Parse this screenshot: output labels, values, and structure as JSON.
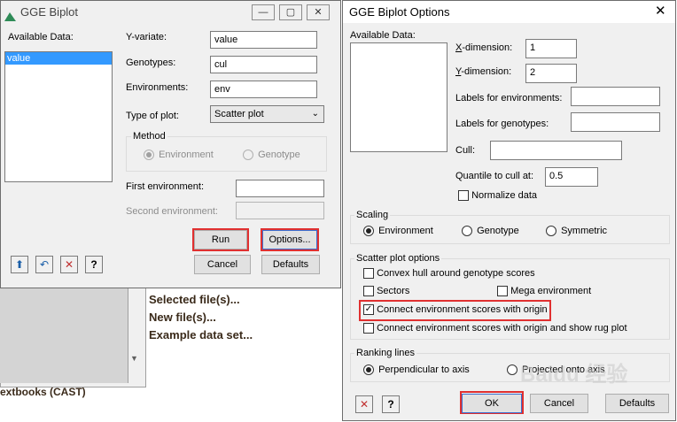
{
  "background": {
    "links": [
      "Selected file(s)...",
      "New file(s)...",
      "Example data set..."
    ],
    "bottom_text": "extbooks (CAST)"
  },
  "gge_biplot": {
    "title": "GGE Biplot",
    "available_data_label": "Available Data:",
    "available_data_items": [
      "value"
    ],
    "y_variate_label": "Y-variate:",
    "y_variate_value": "value",
    "genotypes_label": "Genotypes:",
    "genotypes_value": "cul",
    "environments_label": "Environments:",
    "environments_value": "env",
    "type_of_plot_label": "Type of plot:",
    "type_of_plot_value": "Scatter plot",
    "method_label": "Method",
    "method_options": [
      "Environment",
      "Genotype"
    ],
    "method_selected": "Environment",
    "first_env_label": "First environment:",
    "second_env_label": "Second environment:",
    "run_label": "Run",
    "options_label": "Options...",
    "cancel_label": "Cancel",
    "defaults_label": "Defaults"
  },
  "options": {
    "title": "GGE Biplot Options",
    "available_data_label": "Available Data:",
    "x_dim_label": "X-dimension:",
    "x_dim_value": "1",
    "y_dim_label": "Y-dimension:",
    "y_dim_value": "2",
    "labels_env_label": "Labels for environments:",
    "labels_gen_label": "Labels for genotypes:",
    "cull_label": "Cull:",
    "quantile_label": "Quantile to cull at:",
    "quantile_value": "0.5",
    "normalize_label": "Normalize data",
    "scaling_label": "Scaling",
    "scaling_options": [
      "Environment",
      "Genotype",
      "Symmetric"
    ],
    "scaling_selected": "Environment",
    "scatter_label": "Scatter plot options",
    "convex_hull_label": "Convex hull around genotype scores",
    "sectors_label": "Sectors",
    "mega_env_label": "Mega environment",
    "connect_label": "Connect environment scores with origin",
    "connect_rug_label": "Connect environment scores with origin and show rug plot",
    "ranking_label": "Ranking lines",
    "ranking_options": [
      "Perpendicular to axis",
      "Projected onto axis"
    ],
    "ranking_selected": "Perpendicular to axis",
    "ok_label": "OK",
    "cancel_label": "Cancel",
    "defaults_label": "Defaults"
  },
  "watermark": "Baidu 经验"
}
